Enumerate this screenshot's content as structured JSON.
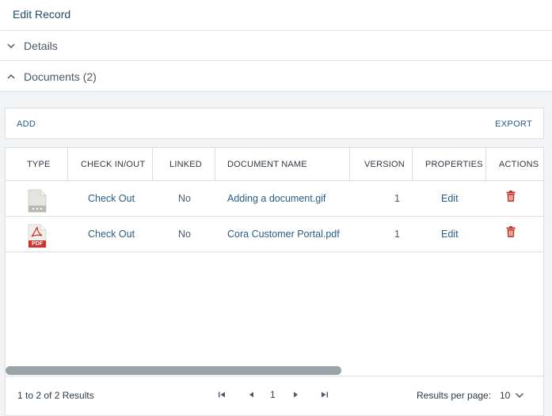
{
  "header": {
    "title": "Edit Record"
  },
  "sections": [
    {
      "label": "Details",
      "state": "collapsed"
    },
    {
      "label": "Documents (2)",
      "state": "expanded"
    }
  ],
  "toolbar": {
    "add_label": "ADD",
    "export_label": "EXPORT"
  },
  "table": {
    "columns": [
      "TYPE",
      "CHECK IN/OUT",
      "LINKED",
      "DOCUMENT NAME",
      "VERSION",
      "PROPERTIES",
      "ACTIONS"
    ],
    "rows": [
      {
        "type_icon": "generic-file-icon",
        "check": "Check Out",
        "linked": "No",
        "name": "Adding a document.gif",
        "version": "1",
        "properties": "Edit",
        "action_icon": "trash-icon"
      },
      {
        "type_icon": "pdf-file-icon",
        "type_badge": "PDF",
        "check": "Check Out",
        "linked": "No",
        "name": "Cora Customer Portal.pdf",
        "version": "1",
        "properties": "Edit",
        "action_icon": "trash-icon"
      }
    ]
  },
  "footer": {
    "summary": "1 to 2 of 2 Results",
    "page": "1",
    "rpp_label": "Results per page:",
    "rpp_value": "10"
  },
  "colors": {
    "link": "#2a5c88",
    "delete": "#c0392b",
    "pdf": "#d0312d"
  }
}
